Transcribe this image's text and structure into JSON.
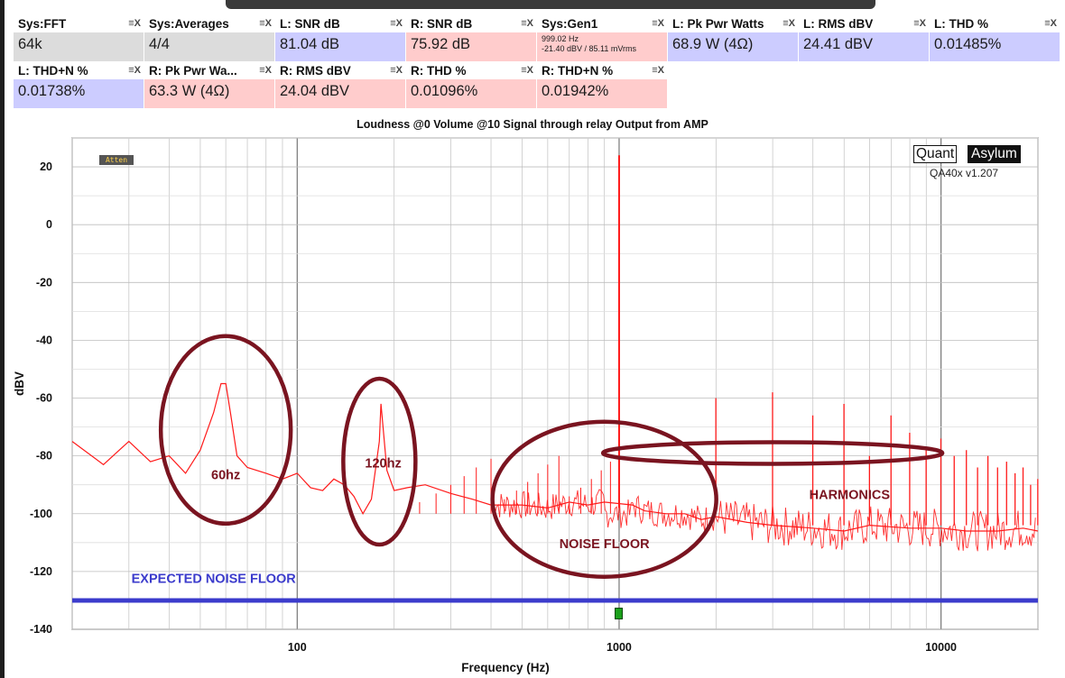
{
  "tiles": [
    {
      "label": "Sys:FFT",
      "value": "64k",
      "color": "gray"
    },
    {
      "label": "Sys:Averages",
      "value": "4/4",
      "color": "gray"
    },
    {
      "label": "L: SNR dB",
      "value": "81.04 dB",
      "color": "blue"
    },
    {
      "label": "R: SNR dB",
      "value": "75.92 dB",
      "color": "red"
    },
    {
      "label": "Sys:Gen1",
      "value_line1": "999.02 Hz",
      "value_line2": "-21.40 dBV  / 85.11 mVrms",
      "color": "red"
    },
    {
      "label": "L: Pk Pwr Watts",
      "value": "68.9 W (4Ω)",
      "color": "blue"
    },
    {
      "label": "L: RMS dBV",
      "value": "24.41 dBV",
      "color": "blue"
    },
    {
      "label": "L: THD %",
      "value": "0.01485%",
      "color": "blue"
    },
    {
      "label": "L: THD+N %",
      "value": "0.01738%",
      "color": "blue"
    },
    {
      "label": "R: Pk Pwr Wa...",
      "value": "63.3 W (4Ω)",
      "color": "red"
    },
    {
      "label": "R: RMS dBV",
      "value": "24.04 dBV",
      "color": "red"
    },
    {
      "label": "R: THD %",
      "value": "0.01096%",
      "color": "red"
    },
    {
      "label": "R: THD+N %",
      "value": "0.01942%",
      "color": "red"
    }
  ],
  "tile_control_icons": [
    "menu-icon",
    "close-icon"
  ],
  "tile_control_text": "≡X",
  "logo": {
    "left": "Quant",
    "right": "Asylum",
    "version": "QA40x v1.207"
  },
  "atten_badge": "Atten",
  "colors": {
    "trace": "#ff1a1a",
    "expected_noise_line": "#3b3bcc",
    "annotation": "#7a1420",
    "blue_tile": "#ccccff",
    "red_tile": "#ffcccc",
    "gray_tile": "#dcdcdc"
  },
  "chart_data": {
    "type": "line",
    "title": "Loudness @0 Volume @10 Signal through relay Output from AMP",
    "xlabel": "Frequency (Hz)",
    "ylabel": "dBV",
    "x_scale": "log",
    "xlim": [
      20,
      20000
    ],
    "ylim": [
      -140,
      30
    ],
    "x_ticks": [
      100,
      1000,
      10000
    ],
    "x_tick_labels": [
      "100",
      "1000",
      "10000"
    ],
    "y_ticks": [
      20,
      0,
      -20,
      -40,
      -60,
      -80,
      -100,
      -120,
      -140
    ],
    "y_tick_labels": [
      "20",
      "0",
      "-20",
      "-40",
      "-60",
      "-80",
      "-100",
      "-120",
      "-140"
    ],
    "grid": true,
    "series": [
      {
        "name": "",
        "role": "measured_spectrum",
        "x": [
          20,
          25,
          30,
          35,
          40,
          45,
          50,
          55,
          58,
          60,
          62,
          65,
          70,
          80,
          90,
          100,
          110,
          120,
          130,
          140,
          150,
          160,
          170,
          180,
          182,
          190,
          200,
          220,
          250,
          300,
          350,
          400,
          450,
          500,
          600,
          700,
          800,
          900,
          999,
          1100,
          1200,
          1400,
          1600,
          1800,
          2000,
          2500,
          3000,
          4000,
          5000,
          6000,
          8000,
          10000,
          12000,
          15000,
          18000,
          20000
        ],
        "y": [
          -75,
          -83,
          -75,
          -82,
          -80,
          -86,
          -78,
          -65,
          -55,
          -55,
          -65,
          -80,
          -84,
          -86,
          -88,
          -86,
          -91,
          -92,
          -88,
          -90,
          -94,
          -100,
          -95,
          -75,
          -62,
          -85,
          -92,
          -91,
          -90,
          -93,
          -95,
          -97,
          -97,
          -97,
          -98,
          -96,
          -97,
          -96,
          24,
          -97,
          -99,
          -100,
          -100,
          -102,
          -101,
          -103,
          -104,
          -105,
          -106,
          -104,
          -105,
          -105,
          -106,
          -106,
          -105,
          -106
        ]
      },
      {
        "name": "",
        "role": "harmonics",
        "x": [
          1000,
          1998,
          2997,
          3996,
          4995,
          5994,
          6993,
          7992,
          8991,
          9990,
          10989,
          11988,
          12987,
          13986,
          14985,
          15984,
          16983,
          17982,
          18981,
          19980
        ],
        "y": [
          24,
          -60,
          -58,
          -66,
          -62,
          -80,
          -66,
          -72,
          -78,
          -74,
          -80,
          -78,
          -84,
          -80,
          -84,
          -82,
          -86,
          -84,
          -90,
          -88
        ]
      },
      {
        "name": "",
        "role": "expected_noise_floor",
        "x": [
          20,
          20000
        ],
        "y": [
          -130,
          -130
        ]
      }
    ],
    "annotations": [
      {
        "text": "60hz",
        "type": "ellipse"
      },
      {
        "text": "120hz",
        "type": "ellipse"
      },
      {
        "text": "NOISE FLOOR",
        "type": "ellipse"
      },
      {
        "text": "HARMONICS",
        "type": "ellipse"
      },
      {
        "text": "EXPECTED NOISE FLOOR",
        "type": "label"
      }
    ]
  }
}
